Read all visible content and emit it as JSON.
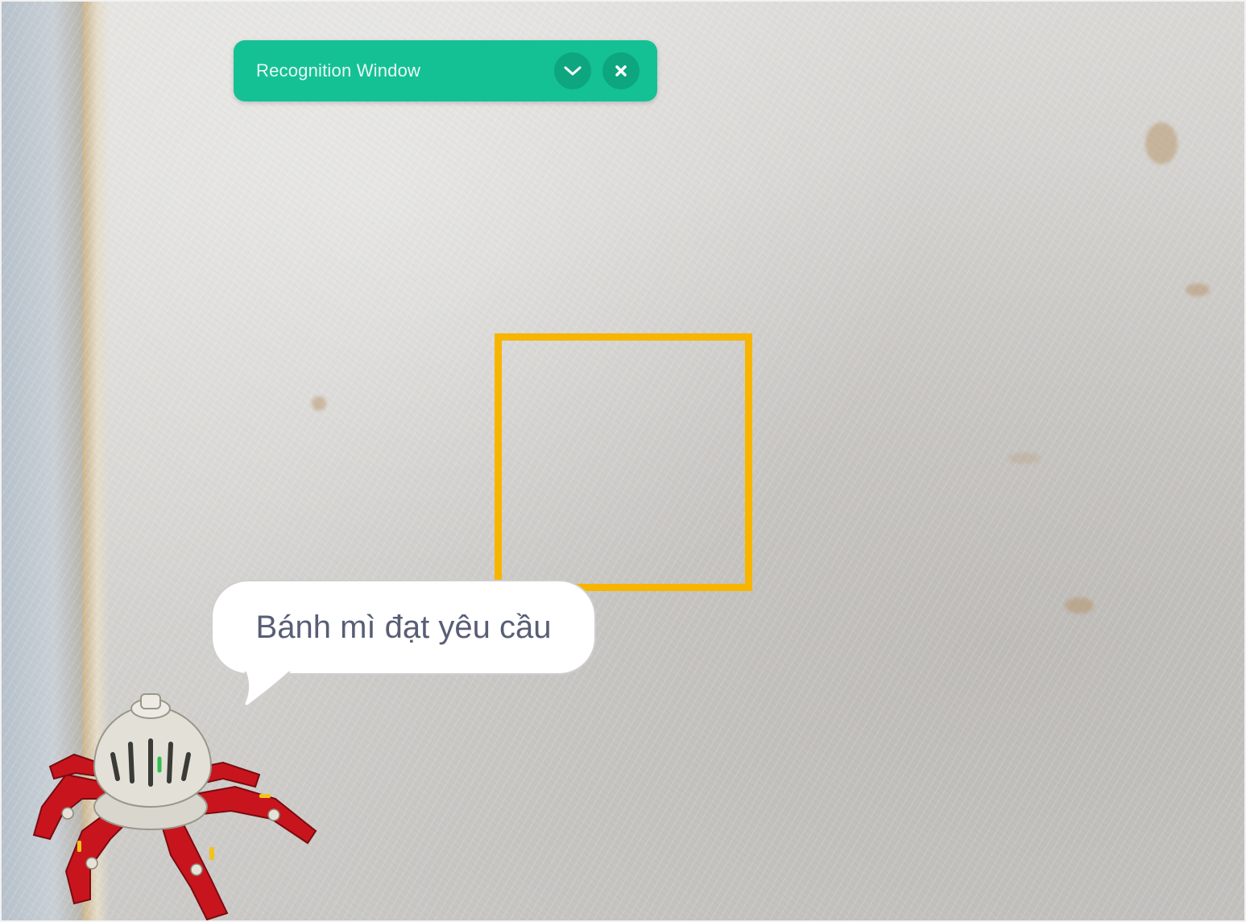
{
  "recognition_window": {
    "title": "Recognition Window",
    "collapse_icon": "chevron-down-icon",
    "close_icon": "close-icon",
    "color": "#14c195"
  },
  "detection": {
    "box_color": "#f7b500"
  },
  "sprite": {
    "speech": "Bánh mì đạt yêu cầu",
    "name_icon": "robot-spider-sprite"
  }
}
